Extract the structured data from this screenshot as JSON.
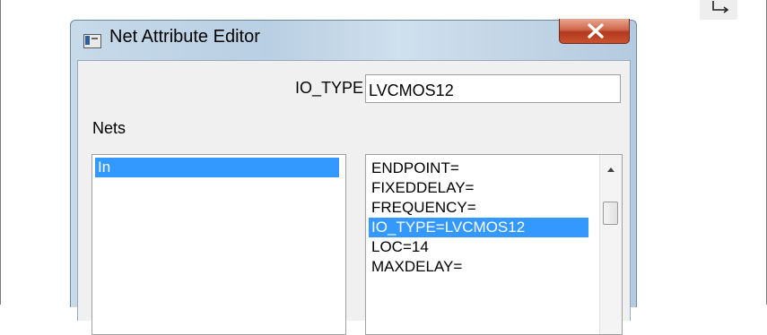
{
  "window": {
    "title": "Net Attribute Editor"
  },
  "io_type": {
    "label": "IO_TYPE",
    "value": "LVCMOS12"
  },
  "nets": {
    "label": "Nets",
    "items": [
      {
        "label": "In",
        "selected": true
      }
    ]
  },
  "attributes": {
    "items": [
      {
        "label": "ENDPOINT=",
        "selected": false
      },
      {
        "label": "FIXEDDELAY=",
        "selected": false
      },
      {
        "label": "FREQUENCY=",
        "selected": false
      },
      {
        "label": "IO_TYPE=LVCMOS12",
        "selected": true
      },
      {
        "label": "LOC=14",
        "selected": false
      },
      {
        "label": "MAXDELAY=",
        "selected": false
      }
    ]
  },
  "colors": {
    "selection": "#3399ff",
    "close_button": "#c8522f"
  },
  "icons": {
    "corner": "return-arrow-icon",
    "app": "window-app-icon",
    "close": "close-icon",
    "scroll_up": "scroll-up-arrow-icon"
  }
}
